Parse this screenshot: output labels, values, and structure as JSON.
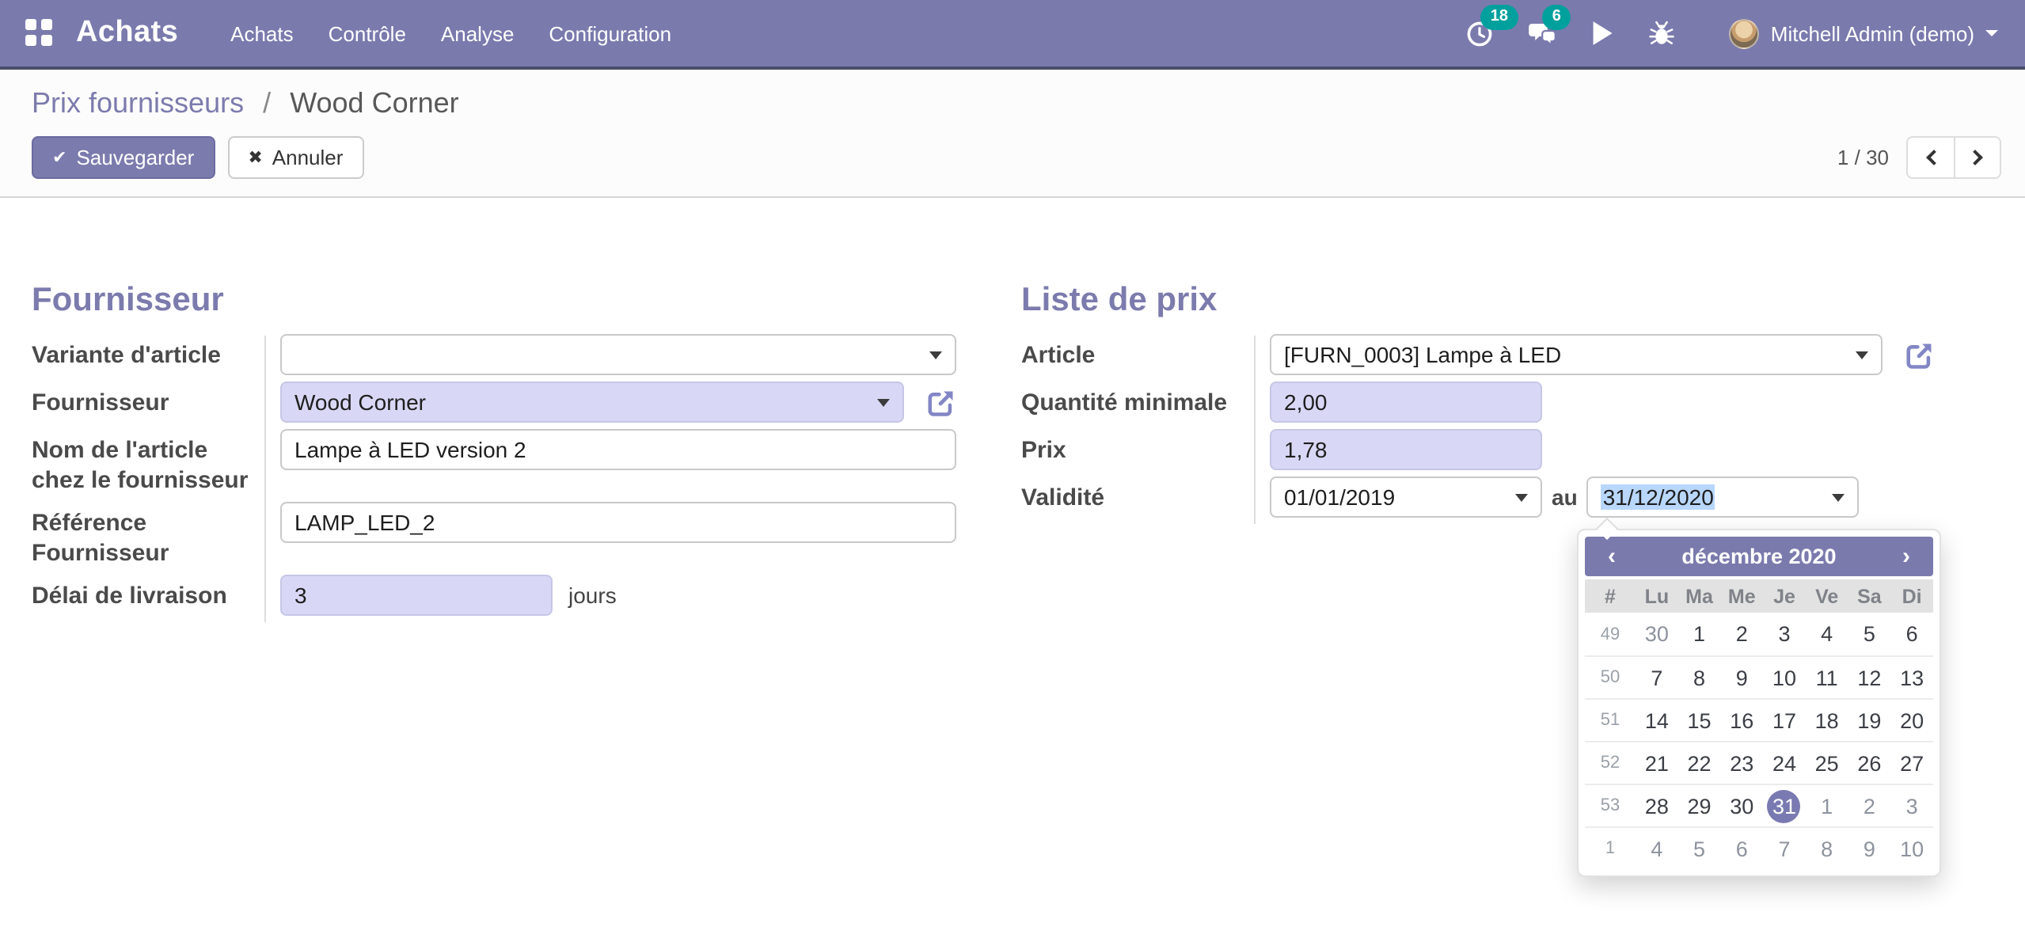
{
  "navbar": {
    "brand": "Achats",
    "menus": [
      "Achats",
      "Contrôle",
      "Analyse",
      "Configuration"
    ],
    "systray": {
      "activities_count": "18",
      "messages_count": "6",
      "user_name": "Mitchell Admin (demo)"
    },
    "colors": {
      "bg": "#7A7AAD",
      "badge": "#00A09D"
    }
  },
  "control_panel": {
    "breadcrumb": {
      "parent": "Prix fournisseurs",
      "separator": "/",
      "current": "Wood Corner"
    },
    "buttons": {
      "save_icon": "✔",
      "save_label": "Sauvegarder",
      "cancel_icon": "✖",
      "cancel_label": "Annuler"
    },
    "pager": {
      "current": "1",
      "separator": "/",
      "total": "30"
    }
  },
  "form": {
    "left": {
      "title": "Fournisseur",
      "fields": {
        "variant": {
          "label": "Variante d'article",
          "value": ""
        },
        "vendor": {
          "label": "Fournisseur",
          "value": "Wood Corner"
        },
        "product_name": {
          "label": "Nom de l'article chez le fournisseur",
          "value": "Lampe à LED version 2"
        },
        "vendor_code": {
          "label": "Référence Fournisseur",
          "value": "LAMP_LED_2"
        },
        "delay": {
          "label": "Délai de livraison",
          "value": "3",
          "suffix": "jours"
        }
      }
    },
    "right": {
      "title": "Liste de prix",
      "fields": {
        "product": {
          "label": "Article",
          "value": "[FURN_0003] Lampe à LED"
        },
        "min_qty": {
          "label": "Quantité minimale",
          "value": "2,00"
        },
        "price": {
          "label": "Prix",
          "value": "1,78"
        },
        "validity": {
          "label": "Validité",
          "start": "01/01/2019",
          "separator": "au",
          "end": "31/12/2020"
        }
      }
    },
    "highlight_color": "#D8D8F6",
    "selection_color": "#B9D7FC"
  },
  "datepicker": {
    "prev": "‹",
    "title": "décembre 2020",
    "next": "›",
    "dow": [
      "#",
      "Lu",
      "Ma",
      "Me",
      "Je",
      "Ve",
      "Sa",
      "Di"
    ],
    "weeks": [
      {
        "n": "49",
        "d": [
          "30",
          "1",
          "2",
          "3",
          "4",
          "5",
          "6"
        ]
      },
      {
        "n": "50",
        "d": [
          "7",
          "8",
          "9",
          "10",
          "11",
          "12",
          "13"
        ]
      },
      {
        "n": "51",
        "d": [
          "14",
          "15",
          "16",
          "17",
          "18",
          "19",
          "20"
        ]
      },
      {
        "n": "52",
        "d": [
          "21",
          "22",
          "23",
          "24",
          "25",
          "26",
          "27"
        ]
      },
      {
        "n": "53",
        "d": [
          "28",
          "29",
          "30",
          "31",
          "1",
          "2",
          "3"
        ]
      },
      {
        "n": "1",
        "d": [
          "4",
          "5",
          "6",
          "7",
          "8",
          "9",
          "10"
        ]
      }
    ],
    "selected_day": "31",
    "header_color": "#7A7AAD"
  },
  "icons": {
    "apps": "grid",
    "activities": "clock",
    "messages": "chat-bubbles",
    "play": "play-triangle",
    "debug": "bug",
    "external": "external-link",
    "save": "check",
    "cancel": "cross"
  }
}
